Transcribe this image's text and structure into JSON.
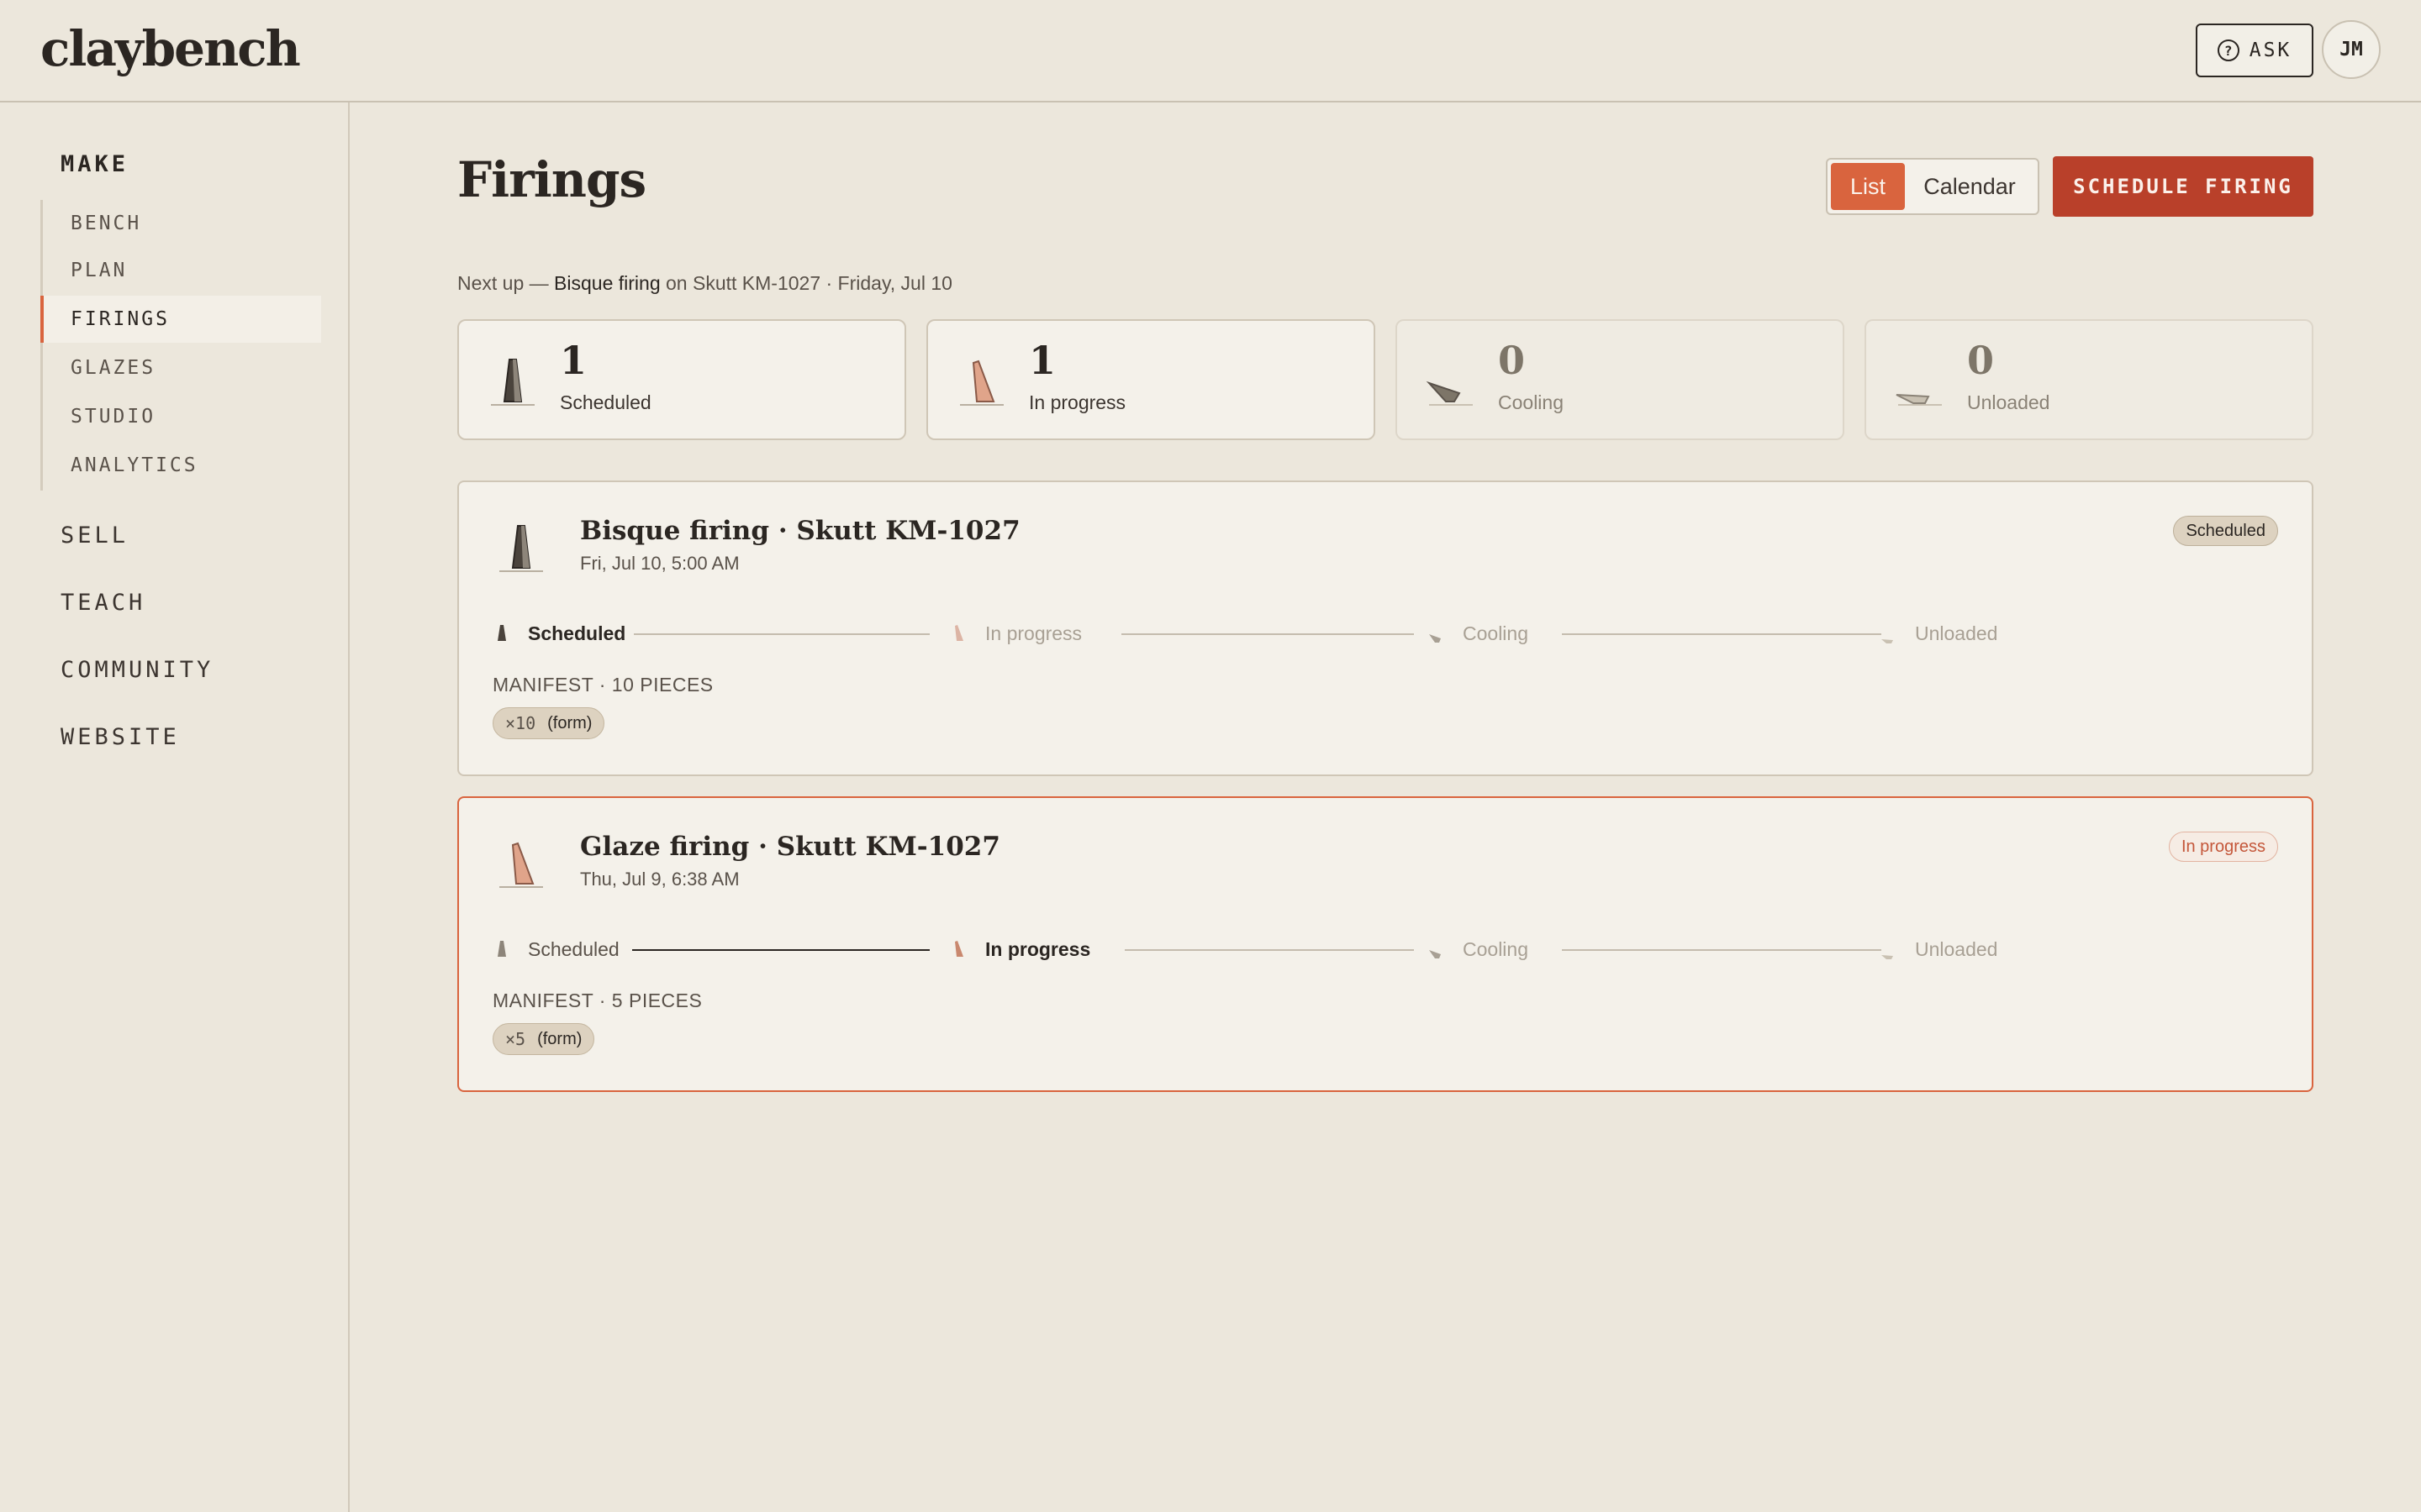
{
  "app": {
    "logo": "claybench"
  },
  "header": {
    "ask_label": "ASK",
    "ask_icon": "help-circle-icon",
    "avatar_initials": "JM"
  },
  "sidebar": {
    "sections": [
      {
        "label": "MAKE",
        "active": true
      },
      {
        "label": "SELL"
      },
      {
        "label": "TEACH"
      },
      {
        "label": "COMMUNITY"
      },
      {
        "label": "WEBSITE"
      }
    ],
    "make_items": [
      {
        "label": "BENCH"
      },
      {
        "label": "PLAN"
      },
      {
        "label": "FIRINGS",
        "active": true
      },
      {
        "label": "GLAZES"
      },
      {
        "label": "STUDIO"
      },
      {
        "label": "ANALYTICS"
      }
    ]
  },
  "main": {
    "title": "Firings",
    "view_toggle": {
      "list": "List",
      "calendar": "Calendar",
      "selected": "List"
    },
    "schedule_button": "SCHEDULE FIRING",
    "next_up": {
      "prefix": "Next up —",
      "firing": "Bisque firing",
      "mid": "on Skutt KM-1027 · Friday, Jul 10"
    },
    "stats": [
      {
        "count": "1",
        "label": "Scheduled"
      },
      {
        "count": "1",
        "label": "In progress"
      },
      {
        "count": "0",
        "label": "Cooling"
      },
      {
        "count": "0",
        "label": "Unloaded"
      }
    ],
    "firings": [
      {
        "title": "Bisque firing · Skutt KM-1027",
        "date": "Fri, Jul 10, 5:00 AM",
        "status": "Scheduled",
        "steps": [
          "Scheduled",
          "In progress",
          "Cooling",
          "Unloaded"
        ],
        "current_step": 0,
        "manifest": "MANIFEST · 10 PIECES",
        "chip_qty": "×10",
        "chip_label": "(form)"
      },
      {
        "title": "Glaze firing · Skutt KM-1027",
        "date": "Thu, Jul 9, 6:38 AM",
        "status": "In progress",
        "steps": [
          "Scheduled",
          "In progress",
          "Cooling",
          "Unloaded"
        ],
        "current_step": 1,
        "manifest": "MANIFEST · 5 PIECES",
        "chip_qty": "×5",
        "chip_label": "(form)"
      }
    ]
  },
  "colors": {
    "background": "#ece7dc",
    "accent": "#d9643e",
    "primary_button": "#b9402a",
    "ink": "#2b2622"
  },
  "icons": [
    "cone-standing-icon",
    "cone-bending-icon",
    "cone-slumped-icon",
    "cone-flat-icon"
  ]
}
